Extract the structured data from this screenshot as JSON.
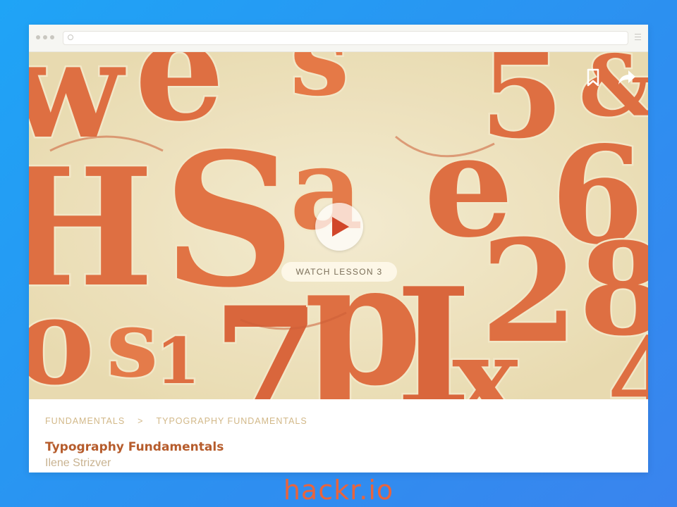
{
  "hero": {
    "cta_label": "WATCH LESSON 3",
    "actions": {
      "bookmark_icon": "bookmark-icon",
      "share_icon": "share-icon"
    },
    "palette": {
      "background": "#efe5c5",
      "letters": "#d9592d",
      "dark": "#c24a22"
    }
  },
  "breadcrumb": {
    "items": [
      "FUNDAMENTALS",
      "TYPOGRAPHY FUNDAMENTALS"
    ],
    "separator": ">"
  },
  "course": {
    "title": "Typography Fundamentals",
    "author": "Ilene Strizver"
  },
  "brand": {
    "name": "hackr.io",
    "color": "#e9643d"
  }
}
